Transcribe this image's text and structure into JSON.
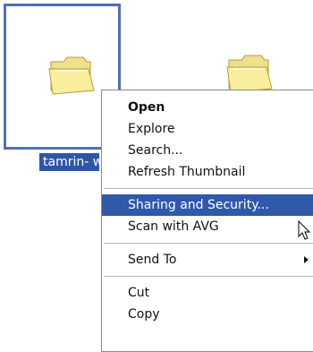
{
  "folders": [
    {
      "label": "tamrin- w",
      "icon": "folder-icon",
      "selected": true
    },
    {
      "label": "",
      "icon": "folder-icon",
      "selected": false
    }
  ],
  "context_menu": {
    "open": "Open",
    "explore": "Explore",
    "search": "Search...",
    "refresh_thumbnail": "Refresh Thumbnail",
    "sharing_security": "Sharing and Security...",
    "scan_avg": "Scan with AVG",
    "send_to": "Send To",
    "cut": "Cut",
    "copy": "Copy"
  },
  "colors": {
    "selection": "#2f56a6",
    "highlight": "#3059aa",
    "folder_fill": "#f4e79a",
    "folder_stroke": "#b89a3a"
  },
  "cursor_icon": "arrow-cursor-icon"
}
